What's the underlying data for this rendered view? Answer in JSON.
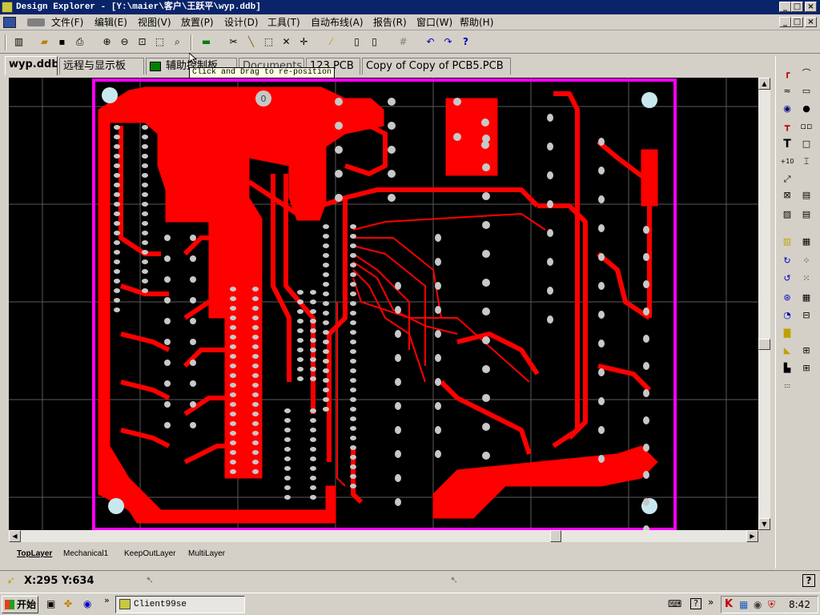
{
  "window": {
    "title": "Design Explorer - [Y:\\maier\\客户\\王跃平\\wyp.ddb]",
    "min": "_",
    "max": "□",
    "close": "×"
  },
  "menu": {
    "items": [
      "文件(F)",
      "编辑(E)",
      "视图(V)",
      "放置(P)",
      "设计(D)",
      "工具(T)",
      "自动布线(A)",
      "报告(R)",
      "窗口(W)",
      "帮助(H)"
    ]
  },
  "tabs": [
    {
      "label": "wyp.ddb"
    },
    {
      "label": "远程与显示板"
    },
    {
      "label": "辅助控制板"
    },
    {
      "label": "Documents"
    },
    {
      "label": "123.PCB"
    },
    {
      "label": "Copy of Copy of PCB5.PCB"
    }
  ],
  "tooltip": "Click and Drag to re-position",
  "pcb": {
    "marker_label": "0",
    "colors": {
      "copper": "#ff0000",
      "board_edge": "#ff00ff",
      "pad": "#c8c8c8",
      "grid": "#5a5a5a",
      "background": "#000000"
    }
  },
  "layers": [
    "TopLayer",
    "Mechanical1",
    "KeepOutLayer",
    "MultiLayer"
  ],
  "status": {
    "coords": "X:295 Y:634"
  },
  "taskbar": {
    "start": "开始",
    "task": "Client99se",
    "clock": "8:42"
  }
}
